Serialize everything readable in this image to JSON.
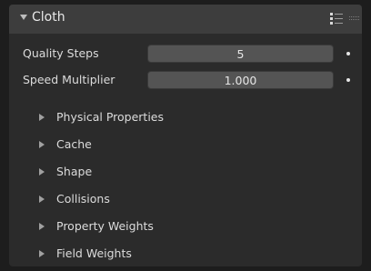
{
  "panel": {
    "title": "Cloth"
  },
  "properties": [
    {
      "label": "Quality Steps",
      "value": "5"
    },
    {
      "label": "Speed Multiplier",
      "value": "1.000"
    }
  ],
  "subpanels": [
    {
      "label": "Physical Properties"
    },
    {
      "label": "Cache"
    },
    {
      "label": "Shape"
    },
    {
      "label": "Collisions"
    },
    {
      "label": "Property Weights"
    },
    {
      "label": "Field Weights"
    }
  ],
  "colors": {
    "background": "#1d1d1d",
    "panel": "#2b2b2b",
    "header": "#3d3d3d",
    "field": "#545454"
  },
  "icons": [
    "list-options-icon",
    "drag-handle-icon",
    "expand-arrow-icon",
    "collapsed-arrow-icon"
  ]
}
